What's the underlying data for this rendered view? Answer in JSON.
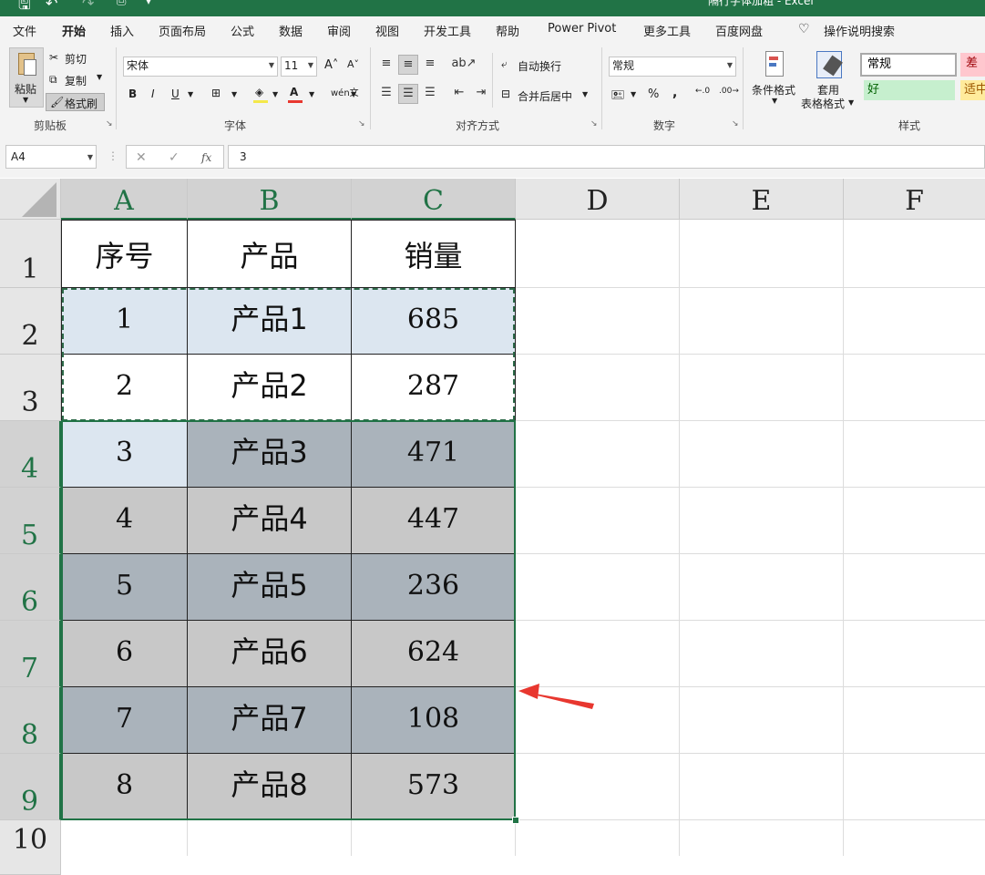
{
  "titlebar": {
    "title": "隔行字体加粗 - Excel"
  },
  "tabs": [
    "文件",
    "开始",
    "插入",
    "页面布局",
    "公式",
    "数据",
    "审阅",
    "视图",
    "开发工具",
    "帮助",
    "Power Pivot",
    "更多工具",
    "百度网盘"
  ],
  "tell_me": "操作说明搜索",
  "clipboard": {
    "paste": "粘贴",
    "cut": "剪切",
    "copy": "复制",
    "format_painter": "格式刷",
    "group": "剪贴板"
  },
  "font": {
    "name": "宋体",
    "size": "11",
    "group": "字体"
  },
  "alignment": {
    "wrap": "自动换行",
    "merge": "合并后居中",
    "group": "对齐方式"
  },
  "number": {
    "format": "常规",
    "group": "数字"
  },
  "styles": {
    "cond_format": "条件格式",
    "table_format_1": "套用",
    "table_format_2": "表格格式",
    "normal": "常规",
    "bad": "差",
    "good": "好",
    "neutral": "适中",
    "group": "样式"
  },
  "formula_bar": {
    "name_box": "A4",
    "value": "3"
  },
  "columns": [
    "A",
    "B",
    "C",
    "D",
    "E",
    "F"
  ],
  "rows": [
    "1",
    "2",
    "3",
    "4",
    "5",
    "6",
    "7",
    "8",
    "9",
    "10"
  ],
  "table": {
    "headers": [
      "序号",
      "产品",
      "销量"
    ],
    "data": [
      [
        "1",
        "产品1",
        "685"
      ],
      [
        "2",
        "产品2",
        "287"
      ],
      [
        "3",
        "产品3",
        "471"
      ],
      [
        "4",
        "产品4",
        "447"
      ],
      [
        "5",
        "产品5",
        "236"
      ],
      [
        "6",
        "产品6",
        "624"
      ],
      [
        "7",
        "产品7",
        "108"
      ],
      [
        "8",
        "产品8",
        "573"
      ]
    ]
  },
  "colors": {
    "accent": "#217346",
    "marching_ants": "#2e6b4a",
    "light_blue": "#dce6f0",
    "gray": "#c8c8c8",
    "blue_gray": "#aab3bb",
    "arrow": "#e8372f"
  }
}
